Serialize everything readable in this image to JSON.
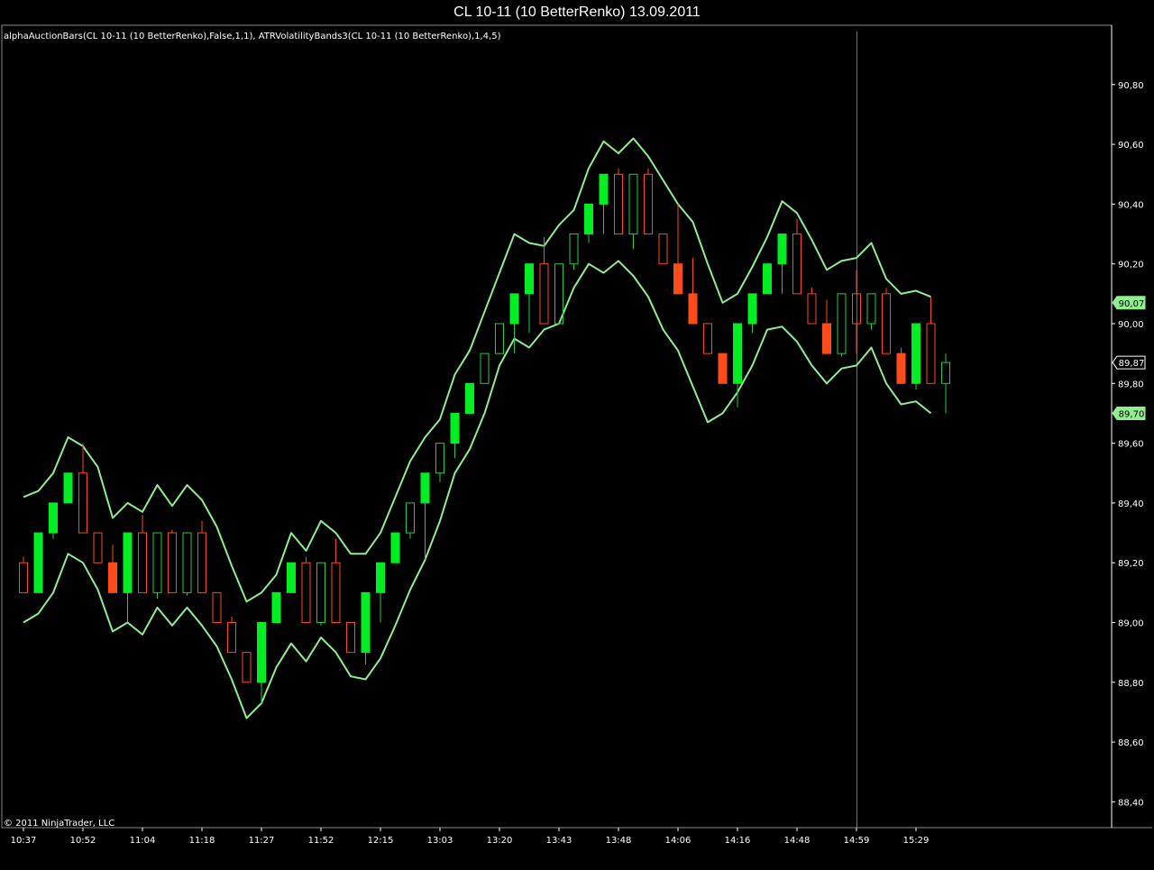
{
  "window": {
    "title": "CL 10-11 (10 BetterRenko)  13.09.2011"
  },
  "panel": {
    "indicator_label": "alphaAuctionBars(CL 10-11 (10 BetterRenko),False,1,1), ATRVolatilityBands3(CL 10-11 (10 BetterRenko),1,4,5)",
    "copyright": "© 2011 NinjaTrader, LLC"
  },
  "colors": {
    "background": "#000000",
    "up_fill": "#00ee22",
    "up_outline": "#22cc44",
    "down_fill": "#ff4a1a",
    "down_outline": "#ff4a1a",
    "band": "#90ee90",
    "crosshair": "#6f6f6f",
    "axis": "#ffffff"
  },
  "chart_data": {
    "type": "candlestick",
    "title": "CL 10-11 (10 BetterRenko)  13.09.2011",
    "ylim": [
      88.3,
      90.92
    ],
    "y_ticks": [
      "88,40",
      "88,60",
      "88,80",
      "89,00",
      "89,20",
      "89,40",
      "89,60",
      "89,80",
      "90,00",
      "90,20",
      "90,40",
      "90,60",
      "90,80"
    ],
    "x_ticks": [
      {
        "label": "10:37",
        "bar": 0
      },
      {
        "label": "10:52",
        "bar": 4
      },
      {
        "label": "11:04",
        "bar": 8
      },
      {
        "label": "11:18",
        "bar": 12
      },
      {
        "label": "11:27",
        "bar": 16
      },
      {
        "label": "11:52",
        "bar": 20
      },
      {
        "label": "12:15",
        "bar": 24
      },
      {
        "label": "13:03",
        "bar": 28
      },
      {
        "label": "13:20",
        "bar": 32
      },
      {
        "label": "13:43",
        "bar": 36
      },
      {
        "label": "13:48",
        "bar": 40
      },
      {
        "label": "14:06",
        "bar": 44
      },
      {
        "label": "14:16",
        "bar": 48
      },
      {
        "label": "14:48",
        "bar": 52
      },
      {
        "label": "14:59",
        "bar": 56
      },
      {
        "label": "15:29",
        "bar": 60
      }
    ],
    "crosshair_bar": 56,
    "price_markers": [
      {
        "label": "90,07",
        "value": 90.07,
        "style": "band"
      },
      {
        "label": "89,87",
        "value": 89.87,
        "style": "price"
      },
      {
        "label": "89,70",
        "value": 89.7,
        "style": "band"
      }
    ],
    "series": [
      {
        "name": "alphaAuctionBars",
        "style": "candlestick",
        "bars": [
          {
            "o": 89.1,
            "h": 89.22,
            "l": 89.1,
            "c": 89.2,
            "up": false,
            "filled": false
          },
          {
            "o": 89.1,
            "h": 89.3,
            "l": 89.1,
            "c": 89.3,
            "up": true,
            "filled": true
          },
          {
            "o": 89.3,
            "h": 89.4,
            "l": 89.28,
            "c": 89.4,
            "up": true,
            "filled": true
          },
          {
            "o": 89.4,
            "h": 89.5,
            "l": 89.4,
            "c": 89.5,
            "up": true,
            "filled": true
          },
          {
            "o": 89.5,
            "h": 89.6,
            "l": 89.3,
            "c": 89.3,
            "up": false,
            "filled": false
          },
          {
            "o": 89.3,
            "h": 89.3,
            "l": 89.2,
            "c": 89.2,
            "up": false,
            "filled": false
          },
          {
            "o": 89.2,
            "h": 89.26,
            "l": 89.1,
            "c": 89.1,
            "up": false,
            "filled": true
          },
          {
            "o": 89.1,
            "h": 89.3,
            "l": 89.0,
            "c": 89.3,
            "up": true,
            "filled": true
          },
          {
            "o": 89.3,
            "h": 89.36,
            "l": 89.1,
            "c": 89.1,
            "up": false,
            "filled": false
          },
          {
            "o": 89.1,
            "h": 89.3,
            "l": 89.08,
            "c": 89.3,
            "up": true,
            "filled": false
          },
          {
            "o": 89.3,
            "h": 89.31,
            "l": 89.1,
            "c": 89.1,
            "up": false,
            "filled": false
          },
          {
            "o": 89.1,
            "h": 89.3,
            "l": 89.09,
            "c": 89.3,
            "up": true,
            "filled": false
          },
          {
            "o": 89.3,
            "h": 89.34,
            "l": 89.1,
            "c": 89.1,
            "up": false,
            "filled": false
          },
          {
            "o": 89.1,
            "h": 89.1,
            "l": 89.0,
            "c": 89.0,
            "up": false,
            "filled": false
          },
          {
            "o": 89.0,
            "h": 89.02,
            "l": 88.9,
            "c": 88.9,
            "up": false,
            "filled": false
          },
          {
            "o": 88.9,
            "h": 88.9,
            "l": 88.8,
            "c": 88.8,
            "up": false,
            "filled": false
          },
          {
            "o": 88.8,
            "h": 89.0,
            "l": 88.73,
            "c": 89.0,
            "up": true,
            "filled": true
          },
          {
            "o": 89.0,
            "h": 89.1,
            "l": 89.0,
            "c": 89.1,
            "up": true,
            "filled": true
          },
          {
            "o": 89.1,
            "h": 89.2,
            "l": 89.1,
            "c": 89.2,
            "up": true,
            "filled": true
          },
          {
            "o": 89.2,
            "h": 89.22,
            "l": 89.0,
            "c": 89.0,
            "up": false,
            "filled": false
          },
          {
            "o": 89.0,
            "h": 89.2,
            "l": 88.99,
            "c": 89.2,
            "up": true,
            "filled": false
          },
          {
            "o": 89.2,
            "h": 89.28,
            "l": 89.0,
            "c": 89.0,
            "up": false,
            "filled": false
          },
          {
            "o": 89.0,
            "h": 89.0,
            "l": 88.9,
            "c": 88.9,
            "up": false,
            "filled": false
          },
          {
            "o": 88.9,
            "h": 89.1,
            "l": 88.86,
            "c": 89.1,
            "up": true,
            "filled": true
          },
          {
            "o": 89.1,
            "h": 89.2,
            "l": 89.0,
            "c": 89.2,
            "up": true,
            "filled": true
          },
          {
            "o": 89.2,
            "h": 89.3,
            "l": 89.2,
            "c": 89.3,
            "up": true,
            "filled": true
          },
          {
            "o": 89.3,
            "h": 89.4,
            "l": 89.28,
            "c": 89.4,
            "up": true,
            "filled": false
          },
          {
            "o": 89.4,
            "h": 89.5,
            "l": 89.21,
            "c": 89.5,
            "up": true,
            "filled": true
          },
          {
            "o": 89.5,
            "h": 89.6,
            "l": 89.47,
            "c": 89.6,
            "up": true,
            "filled": false
          },
          {
            "o": 89.6,
            "h": 89.7,
            "l": 89.55,
            "c": 89.7,
            "up": true,
            "filled": true
          },
          {
            "o": 89.7,
            "h": 89.8,
            "l": 89.7,
            "c": 89.8,
            "up": true,
            "filled": true
          },
          {
            "o": 89.8,
            "h": 89.9,
            "l": 89.8,
            "c": 89.9,
            "up": true,
            "filled": false
          },
          {
            "o": 89.9,
            "h": 90.0,
            "l": 89.9,
            "c": 90.0,
            "up": true,
            "filled": false
          },
          {
            "o": 90.0,
            "h": 90.1,
            "l": 89.9,
            "c": 90.1,
            "up": true,
            "filled": true
          },
          {
            "o": 90.1,
            "h": 90.2,
            "l": 89.97,
            "c": 90.2,
            "up": true,
            "filled": true
          },
          {
            "o": 90.2,
            "h": 90.29,
            "l": 90.0,
            "c": 90.0,
            "up": false,
            "filled": false
          },
          {
            "o": 90.0,
            "h": 90.2,
            "l": 90.0,
            "c": 90.2,
            "up": true,
            "filled": false
          },
          {
            "o": 90.2,
            "h": 90.3,
            "l": 90.18,
            "c": 90.3,
            "up": true,
            "filled": false
          },
          {
            "o": 90.3,
            "h": 90.4,
            "l": 90.27,
            "c": 90.4,
            "up": true,
            "filled": true
          },
          {
            "o": 90.4,
            "h": 90.5,
            "l": 90.3,
            "c": 90.5,
            "up": true,
            "filled": true
          },
          {
            "o": 90.5,
            "h": 90.52,
            "l": 90.3,
            "c": 90.3,
            "up": false,
            "filled": false
          },
          {
            "o": 90.3,
            "h": 90.5,
            "l": 90.25,
            "c": 90.5,
            "up": true,
            "filled": false
          },
          {
            "o": 90.5,
            "h": 90.52,
            "l": 90.3,
            "c": 90.3,
            "up": false,
            "filled": false
          },
          {
            "o": 90.3,
            "h": 90.3,
            "l": 90.2,
            "c": 90.2,
            "up": false,
            "filled": false
          },
          {
            "o": 90.2,
            "h": 90.4,
            "l": 90.1,
            "c": 90.1,
            "up": false,
            "filled": true
          },
          {
            "o": 90.1,
            "h": 90.22,
            "l": 90.0,
            "c": 90.0,
            "up": false,
            "filled": true
          },
          {
            "o": 90.0,
            "h": 90.0,
            "l": 89.9,
            "c": 89.9,
            "up": false,
            "filled": false
          },
          {
            "o": 89.9,
            "h": 89.9,
            "l": 89.8,
            "c": 89.8,
            "up": false,
            "filled": true
          },
          {
            "o": 89.8,
            "h": 90.0,
            "l": 89.72,
            "c": 90.0,
            "up": true,
            "filled": true
          },
          {
            "o": 90.0,
            "h": 90.1,
            "l": 89.97,
            "c": 90.1,
            "up": true,
            "filled": true
          },
          {
            "o": 90.1,
            "h": 90.2,
            "l": 90.1,
            "c": 90.2,
            "up": true,
            "filled": true
          },
          {
            "o": 90.2,
            "h": 90.3,
            "l": 90.1,
            "c": 90.3,
            "up": true,
            "filled": true
          },
          {
            "o": 90.3,
            "h": 90.35,
            "l": 90.1,
            "c": 90.1,
            "up": false,
            "filled": false
          },
          {
            "o": 90.1,
            "h": 90.12,
            "l": 90.0,
            "c": 90.0,
            "up": false,
            "filled": false
          },
          {
            "o": 90.0,
            "h": 90.08,
            "l": 89.9,
            "c": 89.9,
            "up": false,
            "filled": true
          },
          {
            "o": 89.9,
            "h": 90.1,
            "l": 89.89,
            "c": 90.1,
            "up": true,
            "filled": false
          },
          {
            "o": 90.1,
            "h": 90.18,
            "l": 89.9,
            "c": 90.0,
            "up": false,
            "filled": false
          },
          {
            "o": 90.0,
            "h": 90.1,
            "l": 89.98,
            "c": 90.1,
            "up": true,
            "filled": false
          },
          {
            "o": 90.1,
            "h": 90.12,
            "l": 89.9,
            "c": 89.9,
            "up": false,
            "filled": false
          },
          {
            "o": 89.9,
            "h": 89.92,
            "l": 89.8,
            "c": 89.8,
            "up": false,
            "filled": true
          },
          {
            "o": 89.8,
            "h": 90.0,
            "l": 89.78,
            "c": 90.0,
            "up": true,
            "filled": true
          },
          {
            "o": 90.0,
            "h": 90.09,
            "l": 89.8,
            "c": 89.8,
            "up": false,
            "filled": false
          },
          {
            "o": 89.8,
            "h": 89.9,
            "l": 89.7,
            "c": 89.87,
            "up": true,
            "filled": false
          }
        ]
      },
      {
        "name": "ATRVolatilityBands3 Upper",
        "style": "line",
        "values": [
          89.42,
          89.44,
          89.5,
          89.62,
          89.59,
          89.52,
          89.35,
          89.4,
          89.37,
          89.46,
          89.39,
          89.46,
          89.41,
          89.32,
          89.19,
          89.07,
          89.1,
          89.16,
          89.3,
          89.24,
          89.34,
          89.3,
          89.23,
          89.23,
          89.3,
          89.42,
          89.54,
          89.62,
          89.68,
          89.83,
          89.91,
          90.04,
          90.17,
          90.3,
          90.27,
          90.26,
          90.33,
          90.38,
          90.52,
          90.61,
          90.57,
          90.62,
          90.56,
          90.48,
          90.4,
          90.34,
          90.2,
          90.07,
          90.1,
          90.19,
          90.29,
          90.41,
          90.37,
          90.28,
          90.18,
          90.21,
          90.22,
          90.27,
          90.15,
          90.1,
          90.11,
          90.09
        ]
      },
      {
        "name": "ATRVolatilityBands3 Lower",
        "style": "line",
        "values": [
          89.0,
          89.03,
          89.1,
          89.23,
          89.2,
          89.11,
          88.97,
          89.0,
          88.96,
          89.05,
          88.99,
          89.05,
          88.99,
          88.92,
          88.81,
          88.68,
          88.73,
          88.85,
          88.93,
          88.87,
          88.95,
          88.9,
          88.82,
          88.81,
          88.88,
          88.99,
          89.11,
          89.21,
          89.34,
          89.5,
          89.58,
          89.7,
          89.86,
          89.95,
          89.92,
          89.98,
          90.0,
          90.12,
          90.2,
          90.17,
          90.21,
          90.16,
          90.09,
          89.98,
          89.91,
          89.79,
          89.67,
          89.7,
          89.77,
          89.86,
          89.98,
          89.99,
          89.94,
          89.86,
          89.8,
          89.85,
          89.86,
          89.92,
          89.8,
          89.73,
          89.74,
          89.7
        ]
      }
    ]
  }
}
